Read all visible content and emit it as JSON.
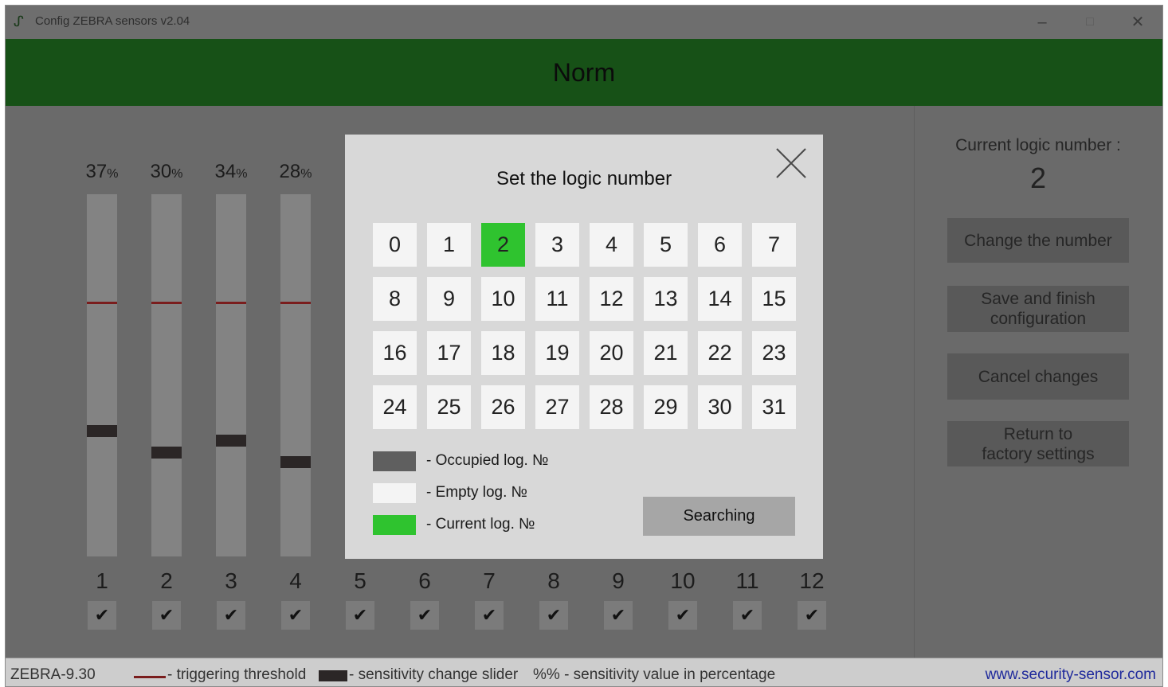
{
  "window": {
    "title": "Config ZEBRA sensors v2.04",
    "controls": {
      "minimize": "–",
      "maximize": "□",
      "close": "✕"
    }
  },
  "status": {
    "text": "Norm"
  },
  "channels": [
    {
      "number": "1",
      "percent": "37",
      "enabled": true
    },
    {
      "number": "2",
      "percent": "30",
      "enabled": true
    },
    {
      "number": "3",
      "percent": "34",
      "enabled": true
    },
    {
      "number": "4",
      "percent": "28",
      "enabled": true
    },
    {
      "number": "5",
      "enabled": true
    },
    {
      "number": "6",
      "enabled": true
    },
    {
      "number": "7",
      "enabled": true
    },
    {
      "number": "8",
      "enabled": true
    },
    {
      "number": "9",
      "enabled": true
    },
    {
      "number": "10",
      "enabled": true
    },
    {
      "number": "11",
      "enabled": true
    },
    {
      "number": "12",
      "enabled": true
    }
  ],
  "percent_sign": "%",
  "check_glyph": "✔",
  "right_panel": {
    "current_label": "Current logic number :",
    "current_value": "2",
    "buttons": {
      "change": "Change the number",
      "save": "Save and finish\nconfiguration",
      "cancel": "Cancel changes",
      "factory": "Return to\nfactory settings"
    }
  },
  "dialog": {
    "title": "Set the logic number",
    "numbers": [
      "0",
      "1",
      "2",
      "3",
      "4",
      "5",
      "6",
      "7",
      "8",
      "9",
      "10",
      "11",
      "12",
      "13",
      "14",
      "15",
      "16",
      "17",
      "18",
      "19",
      "20",
      "21",
      "22",
      "23",
      "24",
      "25",
      "26",
      "27",
      "28",
      "29",
      "30",
      "31"
    ],
    "current": "2",
    "legend": {
      "occupied": "- Occupied log. №",
      "empty": "- Empty log. №",
      "current": "- Current log. №"
    },
    "search_button": "Searching"
  },
  "footer": {
    "model": "ZEBRA-9.30",
    "threshold_legend": "- triggering threshold",
    "slider_legend": "- sensitivity change slider",
    "percent_legend": "%% - sensitivity value in percentage",
    "website": "www.security-sensor.com"
  },
  "colors": {
    "status_bar": "#175117",
    "current_cell": "#2fc32f",
    "occupied_cell": "#5f5f5f",
    "empty_cell": "#f4f4f4",
    "threshold": "#7a1d1d",
    "slider": "#2b2626"
  },
  "icons": {
    "app": "zebra-logo-icon",
    "dialog_close": "close-icon",
    "check": "checkmark-icon"
  }
}
